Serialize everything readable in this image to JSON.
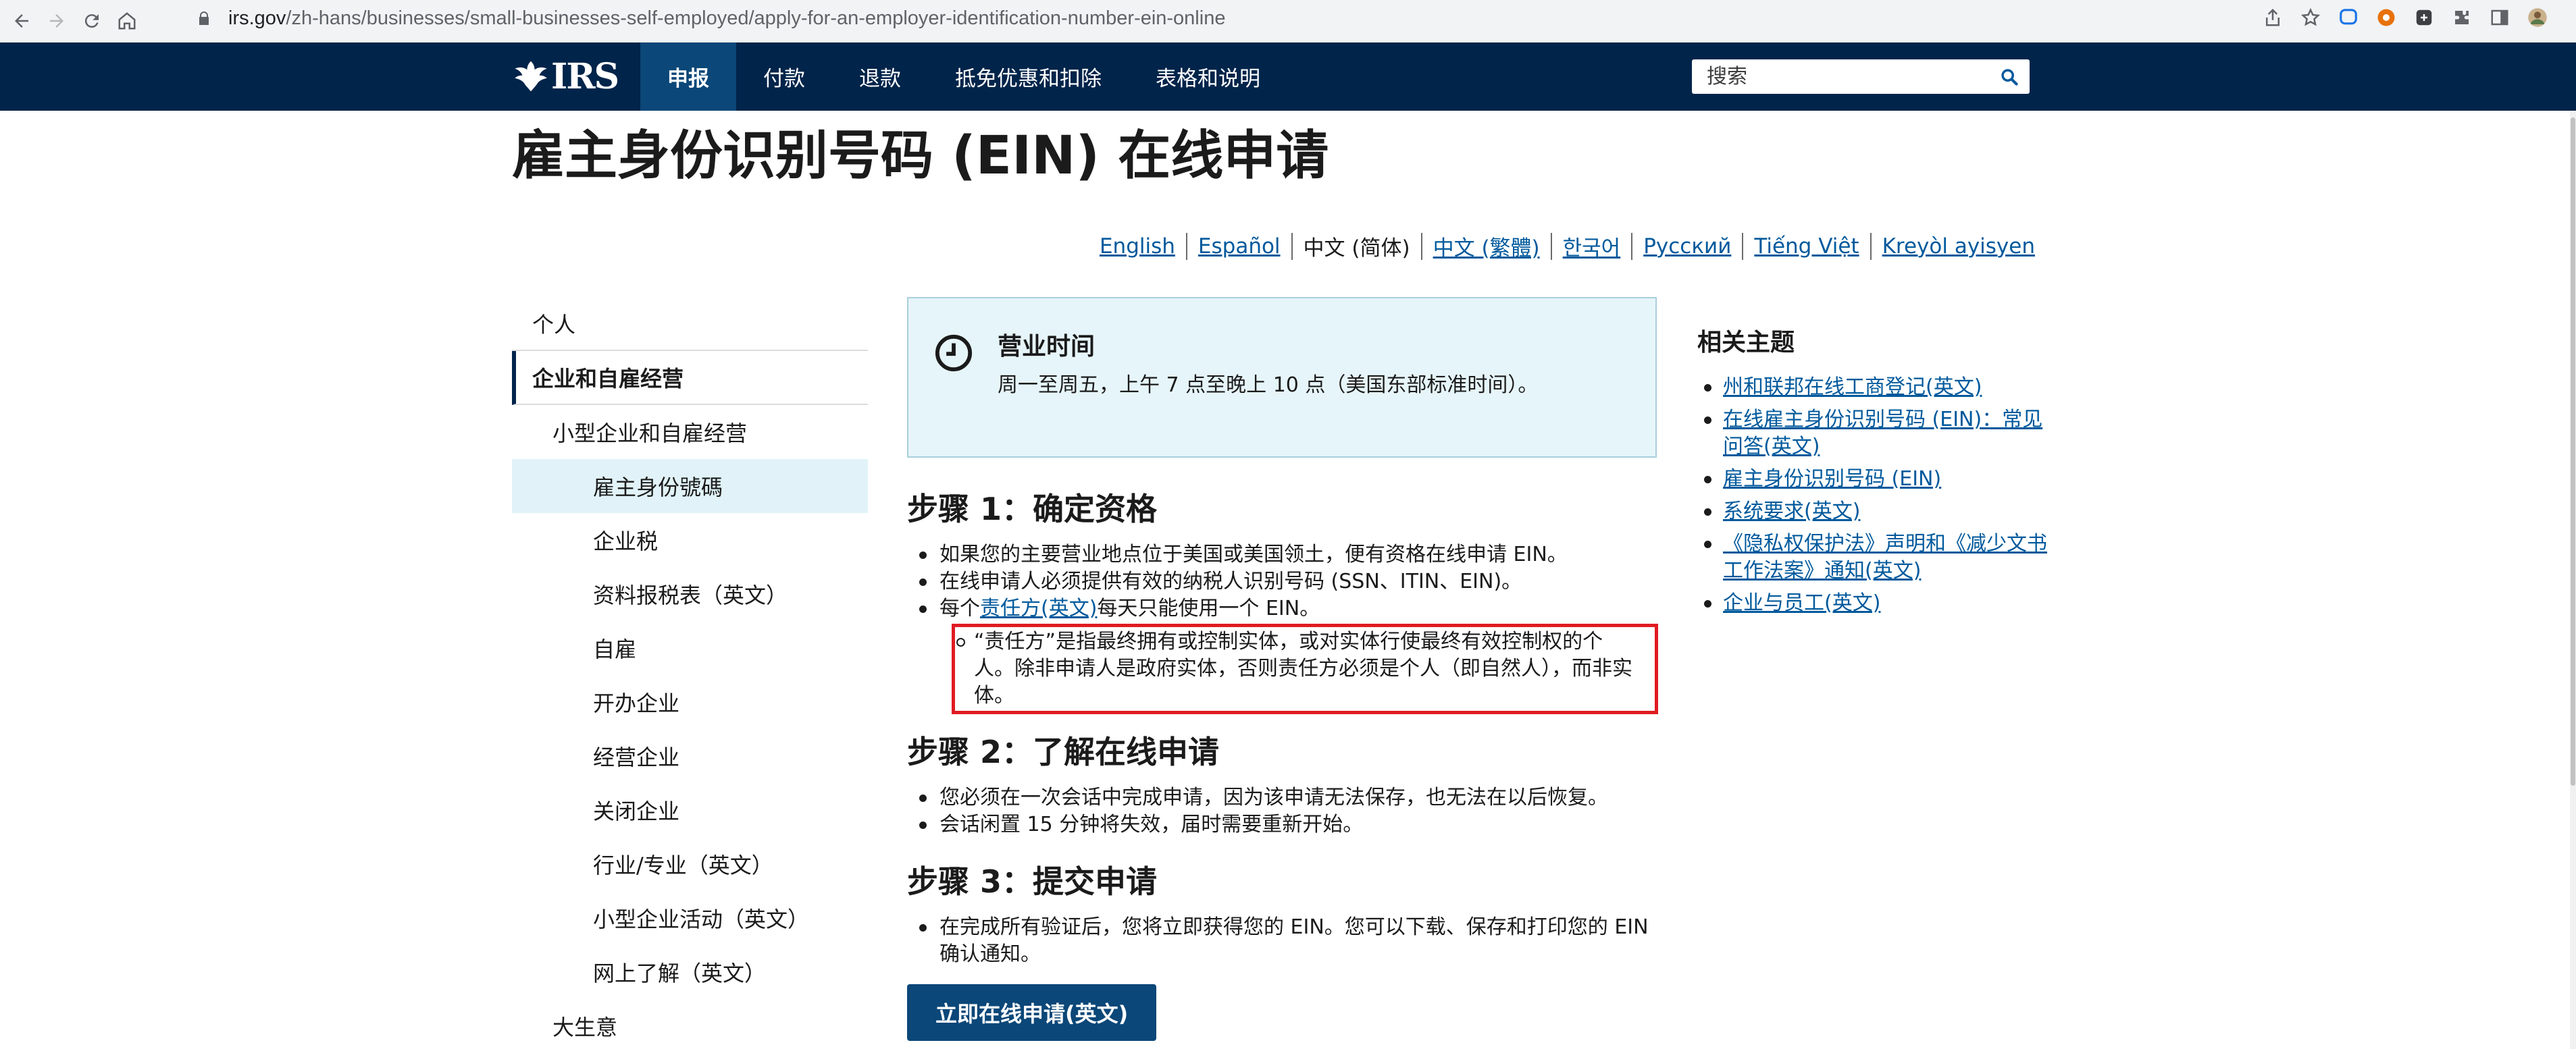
{
  "browser": {
    "url_host": "irs.gov",
    "url_path": "/zh-hans/businesses/small-businesses-self-employed/apply-for-an-employer-identification-number-ein-online",
    "icons": [
      "back-icon",
      "forward-icon",
      "reload-icon",
      "home-icon",
      "lock-icon",
      "share-icon",
      "star-icon",
      "extension-icons",
      "puzzle-icon",
      "sidebar-icon",
      "profile-avatar"
    ]
  },
  "header": {
    "logo_text": "IRS",
    "nav": [
      {
        "label": "申报",
        "active": true
      },
      {
        "label": "付款"
      },
      {
        "label": "退款"
      },
      {
        "label": "抵免优惠和扣除"
      },
      {
        "label": "表格和说明"
      }
    ],
    "search_placeholder": "搜索",
    "colors": {
      "header_bg": "#00244a",
      "active_tab": "#0b4778"
    }
  },
  "page": {
    "title": "雇主身份识别号码 (EIN) 在线申请",
    "languages": [
      {
        "label": "English"
      },
      {
        "label": "Español"
      },
      {
        "label": "中文 (简体)",
        "current": true
      },
      {
        "label": "中文 (繁體)"
      },
      {
        "label": "한국어"
      },
      {
        "label": "Русский"
      },
      {
        "label": "Tiếng Việt"
      },
      {
        "label": "Kreyòl ayisyen"
      }
    ]
  },
  "sidebar": {
    "items": [
      {
        "label": "个人"
      },
      {
        "label": "企业和自雇经营"
      },
      {
        "label": "小型企业和自雇经营"
      },
      {
        "label": "雇主身份號碼"
      },
      {
        "label": "企业税"
      },
      {
        "label": "资料报税表（英文）"
      },
      {
        "label": "自雇"
      },
      {
        "label": "开办企业"
      },
      {
        "label": "经营企业"
      },
      {
        "label": "关闭企业"
      },
      {
        "label": "行业/专业（英文）"
      },
      {
        "label": "小型企业活动（英文）"
      },
      {
        "label": "网上了解（英文）"
      },
      {
        "label": "大生意"
      }
    ]
  },
  "hours": {
    "title": "营业时间",
    "text": "周一至周五，上午 7 点至晚上 10 点（美国东部标准时间）。"
  },
  "steps": [
    {
      "heading": "步骤 1：确定资格",
      "bullets": [
        "如果您的主要营业地点位于美国或美国领土，便有资格在线申请 EIN。",
        "在线申请人必须提供有效的纳税人识别号码 (SSN、ITIN、EIN)。"
      ],
      "bullet3_pre": "每个",
      "bullet3_link": "责任方(英文)",
      "bullet3_post": "每天只能使用一个 EIN。",
      "sub_bullet": "“责任方”是指最终拥有或控制实体，或对实体行使最终有效控制权的个人。除非申请人是政府实体，否则责任方必须是个人（即自然人），而非实体。"
    },
    {
      "heading": "步骤 2：了解在线申请",
      "bullets": [
        "您必须在一次会话中完成申请，因为该申请无法保存，也无法在以后恢复。",
        "会话闲置 15 分钟将失效，届时需要重新开始。"
      ]
    },
    {
      "heading": "步骤 3：提交申请",
      "bullets": [
        "在完成所有验证后，您将立即获得您的 EIN。您可以下载、保存和打印您的 EIN 确认通知。"
      ]
    }
  ],
  "cta_label": "立即在线申请(英文)",
  "related": {
    "title": "相关主题",
    "links": [
      "州和联邦在线工商登记(英文)",
      "在线雇主身份识别号码 (EIN)：常见问答(英文)",
      "雇主身份识别号码 (EIN)",
      "系统要求(英文)",
      "《隐私权保护法》声明和《减少文书工作法案》通知(英文)",
      "企业与员工(英文)"
    ]
  },
  "highlight_color": "#e01b22"
}
